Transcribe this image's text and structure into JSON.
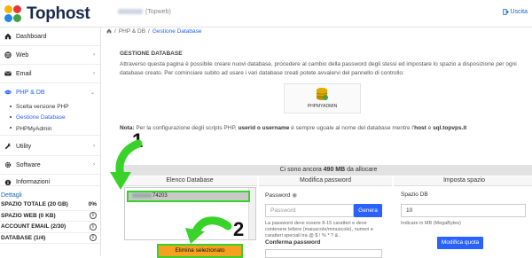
{
  "brand": {
    "name": "Tophost"
  },
  "header": {
    "user_suffix": "(Topweb)",
    "logout_label": "Uscita"
  },
  "sidebar": {
    "items": [
      {
        "label": "Dashboard",
        "icon": "home-icon"
      },
      {
        "label": "Web",
        "icon": "globe-icon"
      },
      {
        "label": "Email",
        "icon": "mail-icon"
      },
      {
        "label": "PHP & DB",
        "icon": "php-icon"
      },
      {
        "label": "Utility",
        "icon": "wrench-icon"
      },
      {
        "label": "Software",
        "icon": "gear-icon"
      },
      {
        "label": "Informazioni",
        "icon": "info-icon"
      }
    ],
    "subitems": [
      "Scelta versione PHP",
      "Gestione Database",
      "PHPMyAdmin"
    ],
    "details_link": "Dettagli",
    "stats": [
      {
        "label": "SPAZIO TOTALE (20 GB)",
        "value": "0%"
      },
      {
        "label": "SPAZIO WEB (0 KB)",
        "value": ""
      },
      {
        "label": "ACCOUNT EMAIL (2/30)",
        "value": ""
      },
      {
        "label": "DATABASE (1/4)",
        "value": ""
      }
    ]
  },
  "breadcrumb": {
    "section": "PHP & DB",
    "separator": "/",
    "current": "Gestione Database"
  },
  "page": {
    "title": "GESTIONE DATABASE",
    "description": "Attraverso questa pagina è possibile creare nuovi database, procedere al cambio della password degli stessi ed impostare lo spazio a disposizione per ogni database creato. Per cominciare subito ad usare i vari database creati potete avvalervi del pannello di controllo:",
    "phpmyadmin_label": "PHPMYADMIN",
    "note_prefix": "Nota:",
    "note_text": " Per la configurazione degli scripts PHP, ",
    "note_bold": "userid o username",
    "note_mid": " è sempre uguale al nome del database mentre l'",
    "note_host": "host",
    "note_tail": " è ",
    "note_server": "sql.topvps.it"
  },
  "panel": {
    "banner_prefix": "Ci sono ancora ",
    "banner_amount": "490 MB",
    "banner_suffix": " da allocare",
    "columns": [
      "Elenco Database",
      "Modifica password",
      "Imposta spazio"
    ],
    "db_item_suffix": "74203",
    "delete_button": "Elimina selezionato",
    "password_label": "Password",
    "password_placeholder": "Password",
    "generate_button": "Genera",
    "password_hint": "La password deve essere 8-15 caratteri e deve contenere lettere (maiuscole/minuscole), numeri e caratteri speciali tra @ $ ! % * ? & .",
    "confirm_label": "Conferma password",
    "space_label": "Spazio DB",
    "space_value": "10",
    "space_hint": "Indicare in MB (MegaBytes)",
    "space_button": "Modifica quota"
  },
  "annotations": {
    "step1": "1",
    "step2": "2",
    "arrow_color": "#39d22a"
  }
}
